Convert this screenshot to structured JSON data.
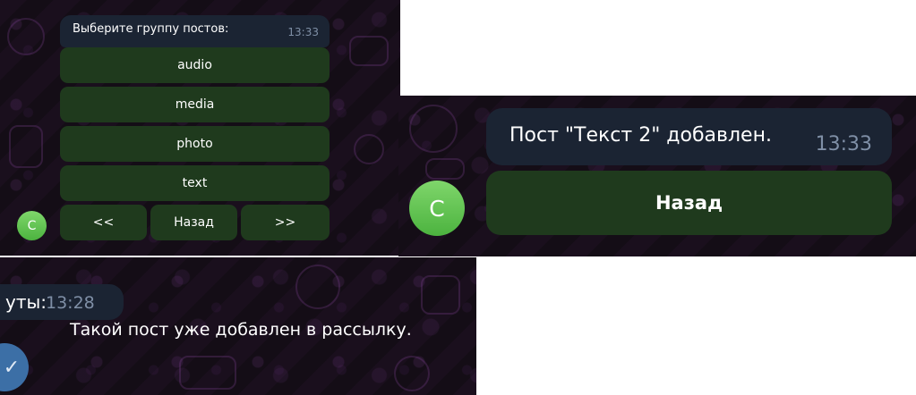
{
  "panel1": {
    "header": {
      "text": "Выберите группу постов:",
      "time": "13:33"
    },
    "buttons": [
      "audio",
      "media",
      "photo",
      "text"
    ],
    "nav": {
      "prev": "<<",
      "back": "Назад",
      "next": ">>"
    },
    "avatar": "C"
  },
  "panel2": {
    "message": {
      "text": "Пост \"Текст 2\" добавлен.",
      "time": "13:33"
    },
    "back": "Назад",
    "avatar": "C"
  },
  "panel3": {
    "prev_message": {
      "text": "уты:",
      "time": "13:28"
    },
    "notice": "Такой пост уже добавлен в рассылку.",
    "check_icon": "✓"
  },
  "colors": {
    "background": "#140d16",
    "bubble": "#1b2433",
    "keyboard_button": "#1f3a1d",
    "avatar_green": "#5cc24b",
    "time_text": "#7f8fa6"
  }
}
